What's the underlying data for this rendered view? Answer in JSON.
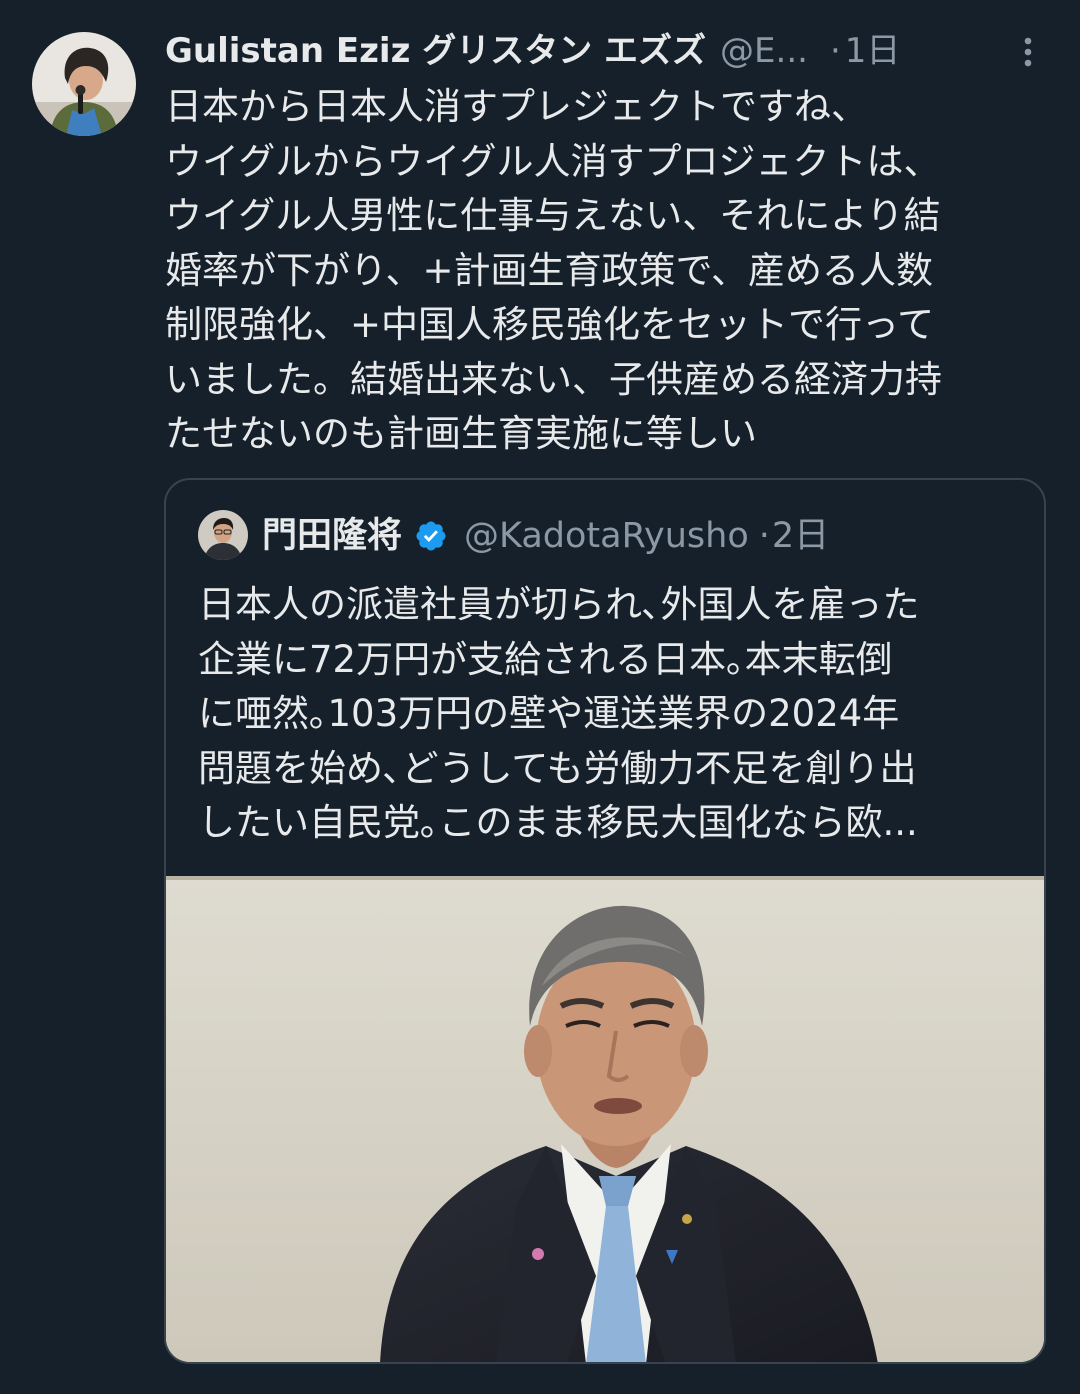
{
  "tweet": {
    "display_name": "Gulistan Eziz グリスタン エズズ",
    "handle": "@E...",
    "separator": "·",
    "time": "1日",
    "text_lines": [
      "日本から日本人消すプレジェクトですね、",
      "ウイグルからウイグル人消すプロジェクトは、",
      "ウイグル人男性に仕事与えない、それにより結",
      "婚率が下がり、+計画生育政策で、産める人数",
      "制限強化、+中国人移民強化をセットで行って",
      "いました。結婚出来ない、子供産める経済力持",
      "たせないのも計画生育実施に等しい"
    ]
  },
  "quote": {
    "display_name": "門田隆将",
    "verified": true,
    "handle": "@KadotaRyusho",
    "separator": "·",
    "time": "2日",
    "text_lines": [
      "日本人の派遣社員が切られ､外国人を雇った",
      "企業に72万円が支給される日本｡本末転倒",
      "に唖然｡103万円の壁や運送業界の2024年",
      "問題を始め､どうしても労働力不足を創り出",
      "したい自民党｡このまま移民大国化なら欧..."
    ]
  },
  "colors": {
    "background": "#15202b",
    "text_primary": "#e7e9ea",
    "text_secondary": "#8b98a5",
    "border": "#38444d",
    "verified_blue": "#1d9bf0"
  },
  "icons": {
    "more": "more-vertical-icon",
    "verified": "verified-badge-icon"
  }
}
